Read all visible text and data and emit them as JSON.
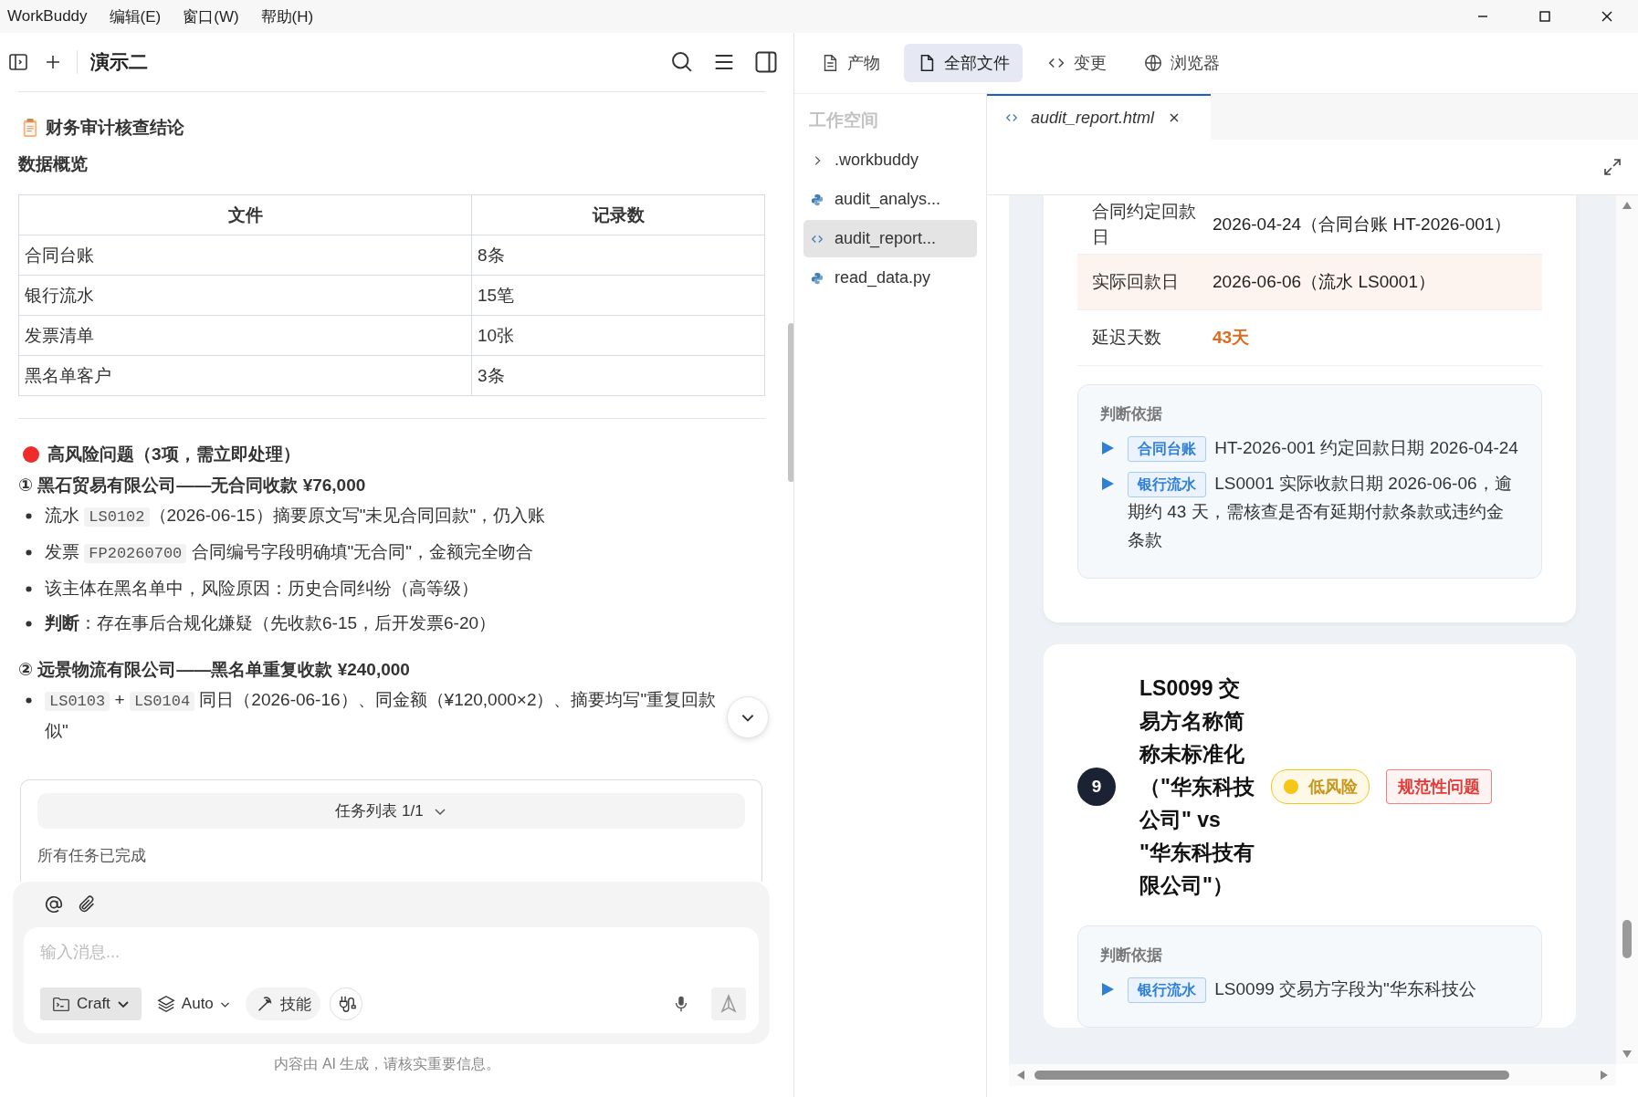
{
  "menu": [
    "WorkBuddy",
    "编辑(E)",
    "窗口(W)",
    "帮助(H)"
  ],
  "chat": {
    "title": "演示二",
    "heading": "财务审计核查结论",
    "subheading": "数据概览",
    "table": {
      "columns": [
        "文件",
        "记录数"
      ],
      "rows": [
        [
          "合同台账",
          "8条"
        ],
        [
          "银行流水",
          "15笔"
        ],
        [
          "发票清单",
          "10张"
        ],
        [
          "黑名单客户",
          "3条"
        ]
      ]
    },
    "risk_title": "高风险问题（3项，需立即处理）",
    "issues": [
      {
        "heading": "① 黑石贸易有限公司——无合同收款 ¥76,000",
        "bullets": [
          [
            {
              "kind": "text",
              "text": "流水 "
            },
            {
              "kind": "code",
              "text": "LS0102"
            },
            {
              "kind": "text",
              "text": "（2026-06-15）摘要原文写\"未见合同回款\"，仍入账"
            }
          ],
          [
            {
              "kind": "text",
              "text": "发票 "
            },
            {
              "kind": "code",
              "text": "FP20260700"
            },
            {
              "kind": "text",
              "text": " 合同编号字段明确填\"无合同\"，金额完全吻合"
            }
          ],
          [
            {
              "kind": "text",
              "text": "该主体在黑名单中，风险原因：历史合同纠纷（高等级）"
            }
          ],
          [
            {
              "kind": "bold",
              "text": "判断"
            },
            {
              "kind": "text",
              "text": "：存在事后合规化嫌疑（先收款6-15，后开发票6-20）"
            }
          ]
        ]
      },
      {
        "heading": "② 远景物流有限公司——黑名单重复收款 ¥240,000",
        "bullets": [
          [
            {
              "kind": "code",
              "text": "LS0103"
            },
            {
              "kind": "text",
              "text": " + "
            },
            {
              "kind": "code",
              "text": "LS0104"
            },
            {
              "kind": "text",
              "text": " 同日（2026-06-16）、同金额（¥120,000×2）、摘要均写\"重复回款"
            },
            {
              "kind": "wrap",
              "text": "似\""
            }
          ]
        ]
      }
    ],
    "tasks": {
      "title": "任务列表 1/1",
      "status": "所有任务已完成"
    },
    "composer": {
      "placeholder": "输入消息...",
      "mode": "Craft",
      "model": "Auto",
      "skills": "技能"
    },
    "footer": "内容由 AI 生成，请核实重要信息。"
  },
  "right": {
    "tabs": [
      {
        "label": "产物",
        "selected": false
      },
      {
        "label": "全部文件",
        "selected": true
      },
      {
        "label": "变更",
        "selected": false
      },
      {
        "label": "浏览器",
        "selected": false
      }
    ],
    "tree": {
      "title": "工作空间",
      "items": [
        {
          "name": ".workbuddy",
          "kind": "folder",
          "expanded": false,
          "selected": false
        },
        {
          "name": "audit_analys...",
          "kind": "python",
          "selected": false
        },
        {
          "name": "audit_report...",
          "kind": "html",
          "selected": true
        },
        {
          "name": "read_data.py",
          "kind": "python",
          "selected": false
        }
      ]
    },
    "editor_tab": "audit_report.html",
    "report": {
      "rows": [
        {
          "label": "合同约定回款日",
          "value": "2026-04-24（合同台账 HT-2026-001）",
          "highlight": false,
          "emphasis": false
        },
        {
          "label": "实际回款日",
          "value": "2026-06-06（流水 LS0001）",
          "highlight": true,
          "emphasis": false
        },
        {
          "label": "延迟天数",
          "value": "43天",
          "highlight": false,
          "emphasis": true
        }
      ],
      "evidence_title": "判断依据",
      "evidence": [
        {
          "tag": "合同台账",
          "text": "HT-2026-001 约定回款日期 2026-04-24"
        },
        {
          "tag": "银行流水",
          "text": "LS0001 实际收款日期 2026-06-06，逾期约 43 天，需核查是否有延期付款条款或违约金条款"
        }
      ],
      "next": {
        "number": "9",
        "title": "LS0099 交易方名称简称未标准化（\"华东科技公司\" vs \"华东科技有限公司\"）",
        "badges": [
          {
            "label": "低风险",
            "kind": "dot",
            "color": "#f5c518"
          },
          {
            "label": "规范性问题",
            "kind": "plain",
            "color": "#e53935"
          }
        ],
        "evidence_title": "判断依据",
        "evidence": [
          {
            "tag": "银行流水",
            "text": "LS0099 交易方字段为\"华东科技公"
          }
        ]
      }
    }
  }
}
